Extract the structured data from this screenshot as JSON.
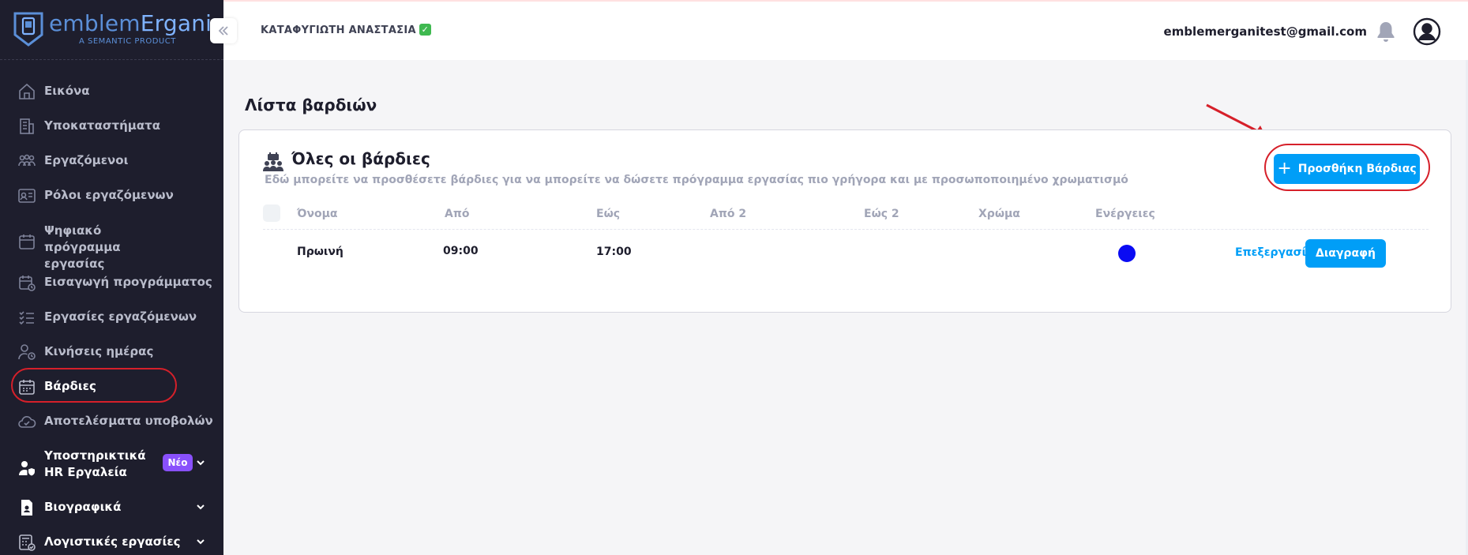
{
  "brand": {
    "name_a": "emblem",
    "name_b": "Ergani",
    "tagline": "A SEMANTIC PRODUCT"
  },
  "topbar": {
    "company": "ΚΑΤΑΦΥΓΙΩΤΗ ΑΝΑΣΤΑΣΙΑ",
    "email": "emblemerganitest@gmail.com"
  },
  "sidebar": {
    "items": [
      {
        "label": "Εικόνα",
        "icon": "home-icon"
      },
      {
        "label": "Υποκαταστήματα",
        "icon": "building-icon"
      },
      {
        "label": "Εργαζόμενοι",
        "icon": "users-icon"
      },
      {
        "label": "Ρόλοι εργαζόμενων",
        "icon": "id-card-icon"
      },
      {
        "label": "Ψηφιακό πρόγραμμα εργασίας",
        "icon": "calendar-icon"
      },
      {
        "label": "Εισαγωγή προγράμματος",
        "icon": "calendar-clock-icon"
      },
      {
        "label": "Εργασίες εργαζόμενων",
        "icon": "checklist-icon"
      },
      {
        "label": "Κινήσεις ημέρας",
        "icon": "user-clock-icon"
      },
      {
        "label": "Βάρδιες",
        "icon": "calendar-grid-icon"
      },
      {
        "label": "Αποτελέσματα υποβολών",
        "icon": "cloud-check-icon"
      },
      {
        "label": "Υποστηρικτικά HR Εργαλεία",
        "icon": "user-shield-icon",
        "badge": "Νέο"
      },
      {
        "label": "Βιογραφικά",
        "icon": "document-person-icon"
      },
      {
        "label": "Λογιστικές εργασίες",
        "icon": "calculator-icon"
      }
    ]
  },
  "main": {
    "page_title": "Λίστα βαρδιών",
    "card": {
      "title": "Όλες οι βάρδιες",
      "subtitle": "Εδώ μπορείτε να προσθέσετε βάρδιες για να μπορείτε να δώσετε πρόγραμμα εργασίας πιο γρήγορα και με προσωποποιημένο χρωματισμό",
      "add_button": "Προσθήκη Βάρδιας",
      "columns": [
        "Όνομα",
        "Από",
        "Εώς",
        "Από 2",
        "Εώς 2",
        "Χρώμα",
        "Ενέργειες"
      ],
      "rows": [
        {
          "name": "Πρωινή",
          "from": "09:00",
          "to": "17:00",
          "from2": "",
          "to2": "",
          "color": "#0a0bf3",
          "edit": "Επεξεργασία",
          "delete": "Διαγραφή"
        }
      ]
    }
  },
  "colors": {
    "sidebar": "#1e1e2d",
    "primary": "#009ef7",
    "highlight": "#d6202a",
    "badge": "#8950fc"
  }
}
